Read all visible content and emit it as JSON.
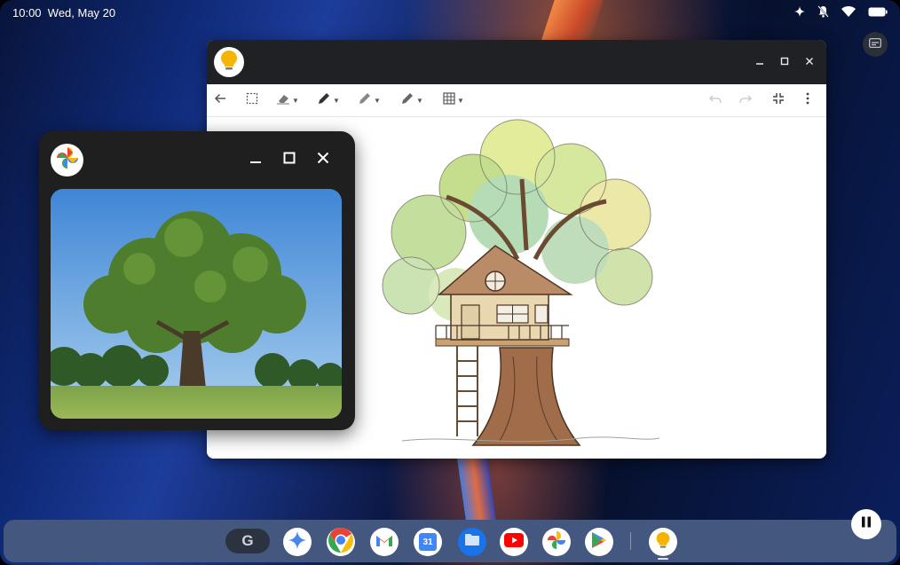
{
  "status_bar": {
    "time": "10:00",
    "date": "Wed, May 20",
    "icons": [
      "sparkle-icon",
      "notifications-off-icon",
      "wifi-icon",
      "battery-icon"
    ]
  },
  "caption_button": {
    "icon": "closed-captions-icon"
  },
  "keep_window": {
    "app_icon": "keep-lightbulb-icon",
    "controls": [
      "minimize-icon",
      "maximize-icon",
      "close-icon"
    ],
    "toolbar": {
      "left": [
        "back-arrow-icon",
        "lasso-select-icon",
        "eraser-icon",
        "pen-icon",
        "pencil-icon",
        "marker-icon",
        "grid-icon"
      ],
      "right": [
        "undo-icon",
        "redo-icon",
        "exit-fullscreen-icon",
        "more-vert-icon"
      ]
    },
    "canvas": {
      "content": "treehouse-sketch"
    }
  },
  "photos_window": {
    "app_icon": "google-photos-icon",
    "controls": [
      "minimize-icon",
      "maximize-icon",
      "close-icon"
    ],
    "photo": {
      "content": "oak-tree-photo"
    }
  },
  "shelf": {
    "launcher_label": "G",
    "apps": [
      {
        "name": "gemini",
        "icon": "gemini-icon"
      },
      {
        "name": "chrome",
        "icon": "chrome-icon"
      },
      {
        "name": "gmail",
        "icon": "gmail-icon"
      },
      {
        "name": "calendar",
        "icon": "calendar-icon",
        "label": "31"
      },
      {
        "name": "files",
        "icon": "files-icon"
      },
      {
        "name": "youtube",
        "icon": "youtube-icon"
      },
      {
        "name": "photos",
        "icon": "google-photos-icon"
      },
      {
        "name": "play-store",
        "icon": "play-store-icon"
      },
      {
        "name": "keep",
        "icon": "keep-lightbulb-icon"
      }
    ]
  },
  "pause_button": {
    "icon": "pause-icon"
  },
  "colors": {
    "shelf": "#44577e",
    "titlebar": "#202124",
    "photos_window": "#1f1f1f",
    "accent_blue": "#1a73e8"
  }
}
